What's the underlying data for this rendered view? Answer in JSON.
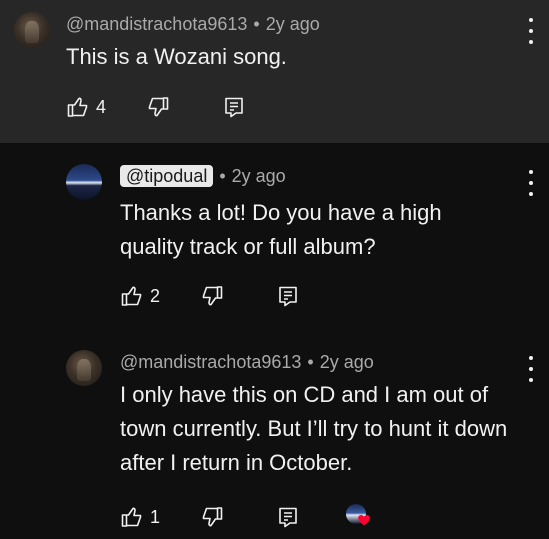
{
  "comments": [
    {
      "author": "@mandistrachota9613",
      "time": "2y ago",
      "text": "This is a Wozani song.",
      "likes": "4"
    },
    {
      "author": "@tipodual",
      "time": "2y ago",
      "text": "Thanks a lot! Do you have a high quality track or full album?",
      "likes": "2"
    },
    {
      "author": "@mandistrachota9613",
      "time": "2y ago",
      "text": "I only have this on CD and I am out of town currently. But I’ll try to hunt it down after I return in October.",
      "likes": "1"
    }
  ],
  "separator": "•",
  "icons": {
    "like": "thumbs-up-icon",
    "dislike": "thumbs-down-icon",
    "reply": "reply-comment-icon",
    "menu": "more-vertical-icon",
    "heart": "creator-heart-icon"
  },
  "colors": {
    "background": "#0f0f0f",
    "highlight_background": "#272727",
    "secondary_text": "#aaaaaa",
    "heart": "#ff0033"
  }
}
